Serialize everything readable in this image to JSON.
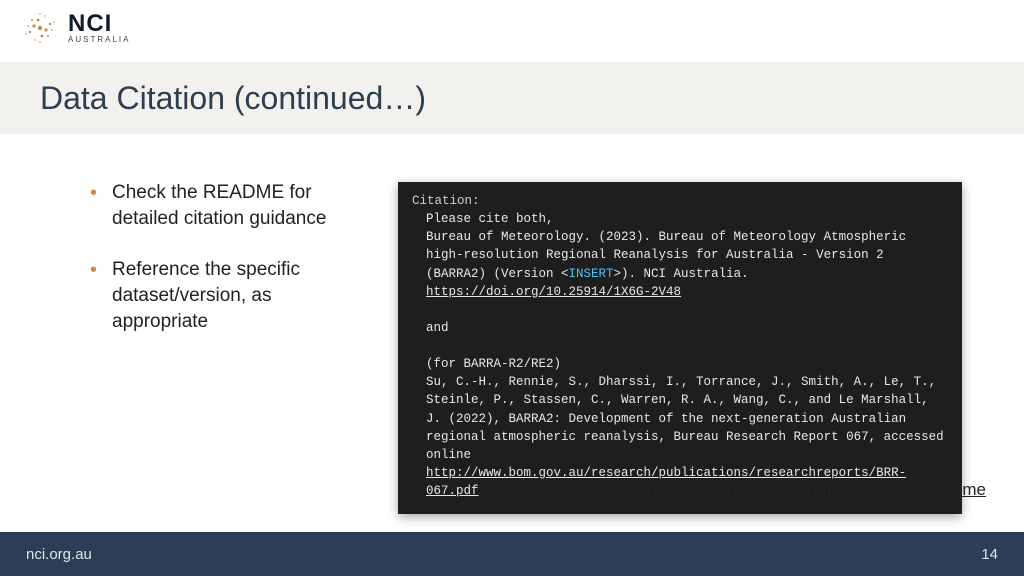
{
  "logo": {
    "main": "NCI",
    "sub": "AUSTRALIA"
  },
  "title": "Data Citation (continued…)",
  "bullets": [
    "Check the README for detailed citation guidance",
    "Reference the specific dataset/version, as appropriate"
  ],
  "terminal": {
    "header": "Citation:",
    "l1": "Please cite both,",
    "l2a": "Bureau of Meteorology. (2023). Bureau of Meteorology Atmospheric high-resolution Regional Reanalysis for Australia - Version 2 (BARRA2) (Version <",
    "insert": "INSERT",
    "l2b": ">). NCI Australia. ",
    "doi": "https://doi.org/10.25914/1X6G-2V48",
    "and": "and",
    "for": "(for BARRA-R2/RE2)",
    "l3a": "Su, C.-H., Rennie, S., Dharssi, I., Torrance, J., Smith, A., Le, T., Steinle, P., Stassen, C., Warren, R. A., Wang, C., and Le Marshall, J. (2022), BARRA2: Development of the next-generation Australian regional atmospheric reanalysis, Bureau Research Report 067, accessed online ",
    "url": "http://www.bom.gov.au/research/publications/researchreports/BRR-067.pdf"
  },
  "moreinfo": {
    "prefix": "More info: ",
    "link1": "BARRA2 Readme",
    "amp": " & ",
    "link2": "BARPA Readme"
  },
  "footer": {
    "site": "nci.org.au",
    "page": "14"
  }
}
